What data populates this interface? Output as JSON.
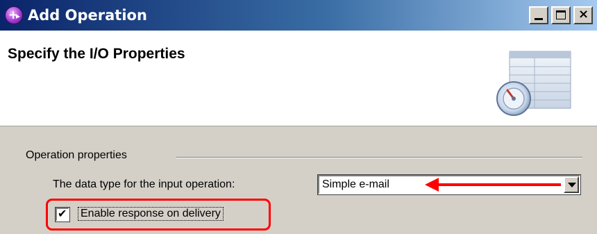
{
  "window": {
    "title": "Add Operation",
    "icon": "add-operation-icon"
  },
  "title_buttons": {
    "minimize_icon": "minimize-icon",
    "maximize_icon": "maximize-icon",
    "close_icon": "close-icon"
  },
  "header": {
    "title": "Specify the I/O Properties",
    "graphic_icon": "wizard-banner-icon"
  },
  "section": {
    "label": "Operation properties"
  },
  "input_type": {
    "label": "The data type for the input operation:",
    "value": "Simple e-mail"
  },
  "response": {
    "label": "Enable response on delivery",
    "checked": true
  },
  "annotations": {
    "highlight_color": "#ff0000"
  }
}
